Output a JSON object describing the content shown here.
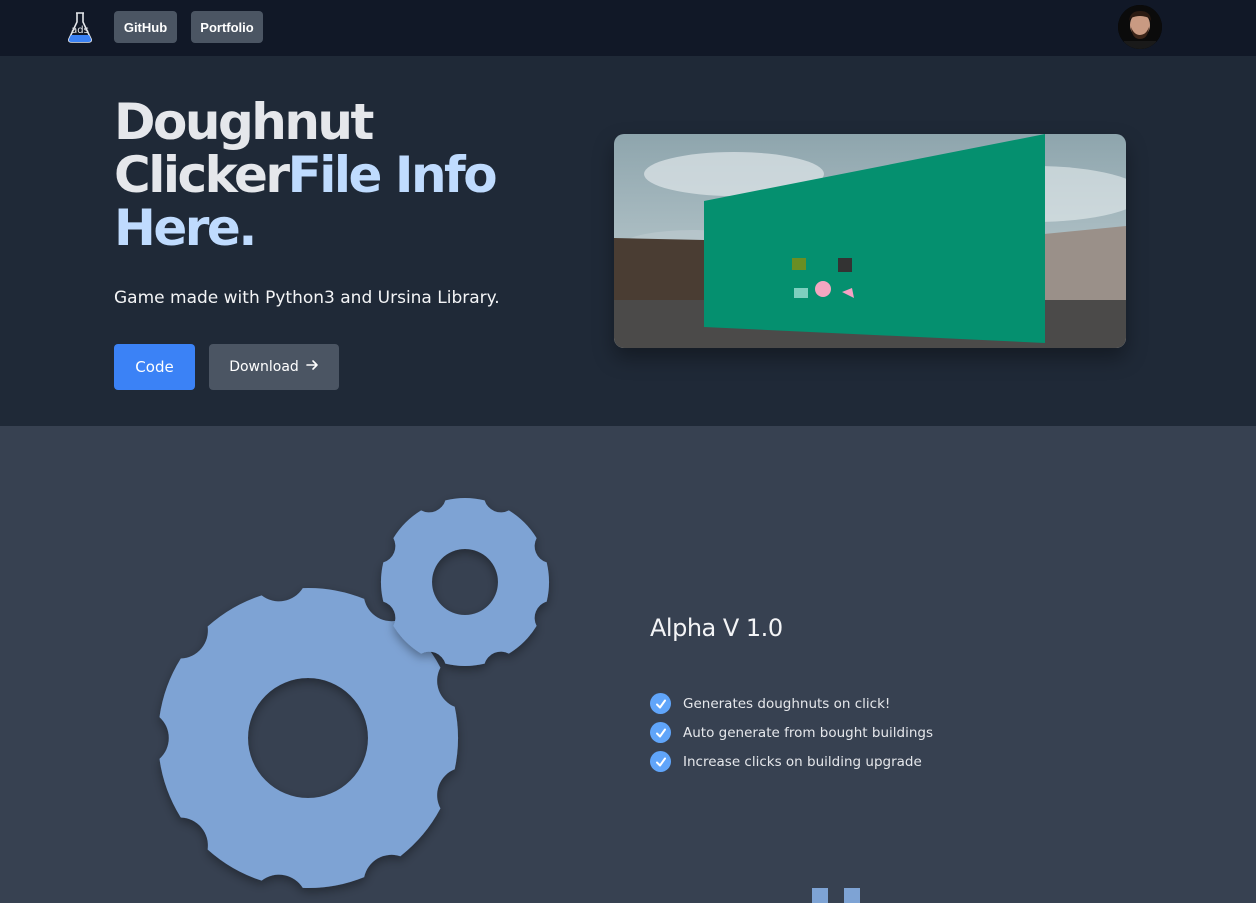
{
  "nav": {
    "logo_icon": "ads-flask-logo-icon",
    "github_label": "GitHub",
    "portfolio_label": "Portfolio",
    "avatar_icon": "user-avatar"
  },
  "hero": {
    "title_part1": "Doughnut Clicker",
    "title_part2": "File Info Here.",
    "subtitle": "Game made with Python3 and Ursina Library.",
    "code_label": "Code",
    "download_label": "Download",
    "download_icon": "arrow-right-icon",
    "screenshot_icon": "game-screenshot"
  },
  "features": {
    "illustration_icon": "gears-icon",
    "version": "Alpha V 1.0",
    "items": [
      "Generates doughnuts on click!",
      "Auto generate from bought buildings",
      "Increase clicks on building upgrade"
    ]
  },
  "colors": {
    "nav_bg": "#111827",
    "hero_bg": "#1f2937",
    "section_bg": "#374151",
    "accent": "#bfdbfe",
    "primary": "#3b82f6",
    "gear": "#7ea3d4"
  }
}
